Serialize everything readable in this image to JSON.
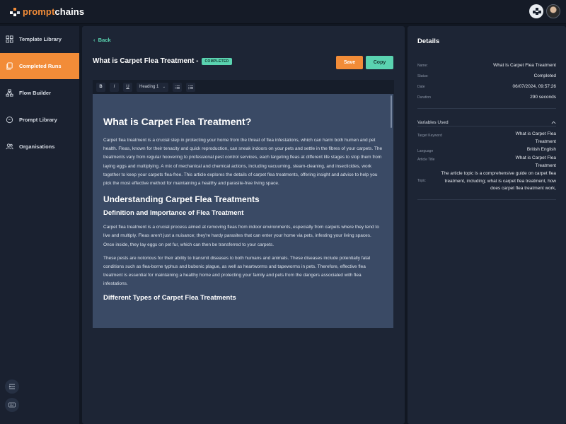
{
  "app": {
    "logo_part1": "prompt",
    "logo_part2": "chains"
  },
  "sidebar": {
    "items": [
      {
        "label": "Template Library",
        "icon": "template-icon"
      },
      {
        "label": "Completed Runs",
        "icon": "runs-icon"
      },
      {
        "label": "Flow Builder",
        "icon": "flow-icon"
      },
      {
        "label": "Prompt Library",
        "icon": "chat-icon"
      },
      {
        "label": "Organisations",
        "icon": "users-icon"
      }
    ],
    "active_index": 1
  },
  "main": {
    "back_label": "Back",
    "title": "What is Carpet Flea Treatment -",
    "status_badge": "COMPLETED",
    "save_label": "Save",
    "copy_label": "Copy",
    "toolbar": {
      "bold": "B",
      "italic": "I",
      "underline": "U",
      "heading_select": "Heading 1"
    },
    "article": {
      "h1": "What is Carpet Flea Treatment?",
      "p1": "Carpet flea treatment is a crucial step in protecting your home from the threat of flea infestations, which can harm both humen and pet health. Fleas, known for their tenacity and quick reproduction, can sneak indoors on your pets and settle in the fibres of your carpets. The treatments vary from regular hoovering to professional pest control services, each targeting fleas at different life stages to stop them from laying eggs and multiplying. A mix of mechanical and chemical actions, including vacuuming, steam-cleaning, and insecticides, work together to keep your carpets flea-free. This article explores the details of carpet flea treatments, offering insight and advice to help you pick the most effective method for maintaining a healthy and parasite-free living space.",
      "h2": "Understanding Carpet Flea Treatments",
      "h3": "Definition and Importance of Flea Treatment",
      "p2": "Carpet flea treatment is a crucial process aimed at removing fleas from indoor environments, especially from carpets where they tend to live and multiply. Fleas aren't just a nuisance; they're hardy parasites that can enter your home via pets, infesting your living spaces. Once inside, they lay eggs on pet fur, which can then be transferred to your carpets.",
      "p3": "These pests are notorious for their ability to transmit diseases to both humans and animals. These diseases include potentially fatal conditions such as flea-borne typhus and bubonic plague, as well as heartworms and tapeworms in pets. Therefore, effective flea treatment is essential for maintaining a healthy home and protecting your family and pets from the dangers associated with flea infestations.",
      "h3_cut": "Different Types of Carpet Flea Treatments"
    }
  },
  "details": {
    "title": "Details",
    "rows": [
      {
        "label": "Name:",
        "value": "What Is Carpet Flea Treatment"
      },
      {
        "label": "Status:",
        "value": "Completed"
      },
      {
        "label": "Date",
        "value": "06/07/2024, 09:57:26"
      },
      {
        "label": "Duration",
        "value": "290 seconds"
      }
    ],
    "variables_title": "Variables Used",
    "variables": [
      {
        "label": "Target Keyword",
        "value": "What is Carpet Flea Treatment"
      },
      {
        "label": "Language",
        "value": "British English"
      },
      {
        "label": "Article Title",
        "value": "What is Carpet Flea Treatment"
      },
      {
        "label": "Topic",
        "value": "The article topic is a comprehensive guide on carpet flea treatment, including; what is carpet flea treatment, how does carpet flea treatment work,"
      }
    ]
  },
  "colors": {
    "accent_orange": "#f28c38",
    "accent_teal": "#5ad3b0",
    "panel": "#1d2535",
    "editor": "#3a4a65"
  }
}
